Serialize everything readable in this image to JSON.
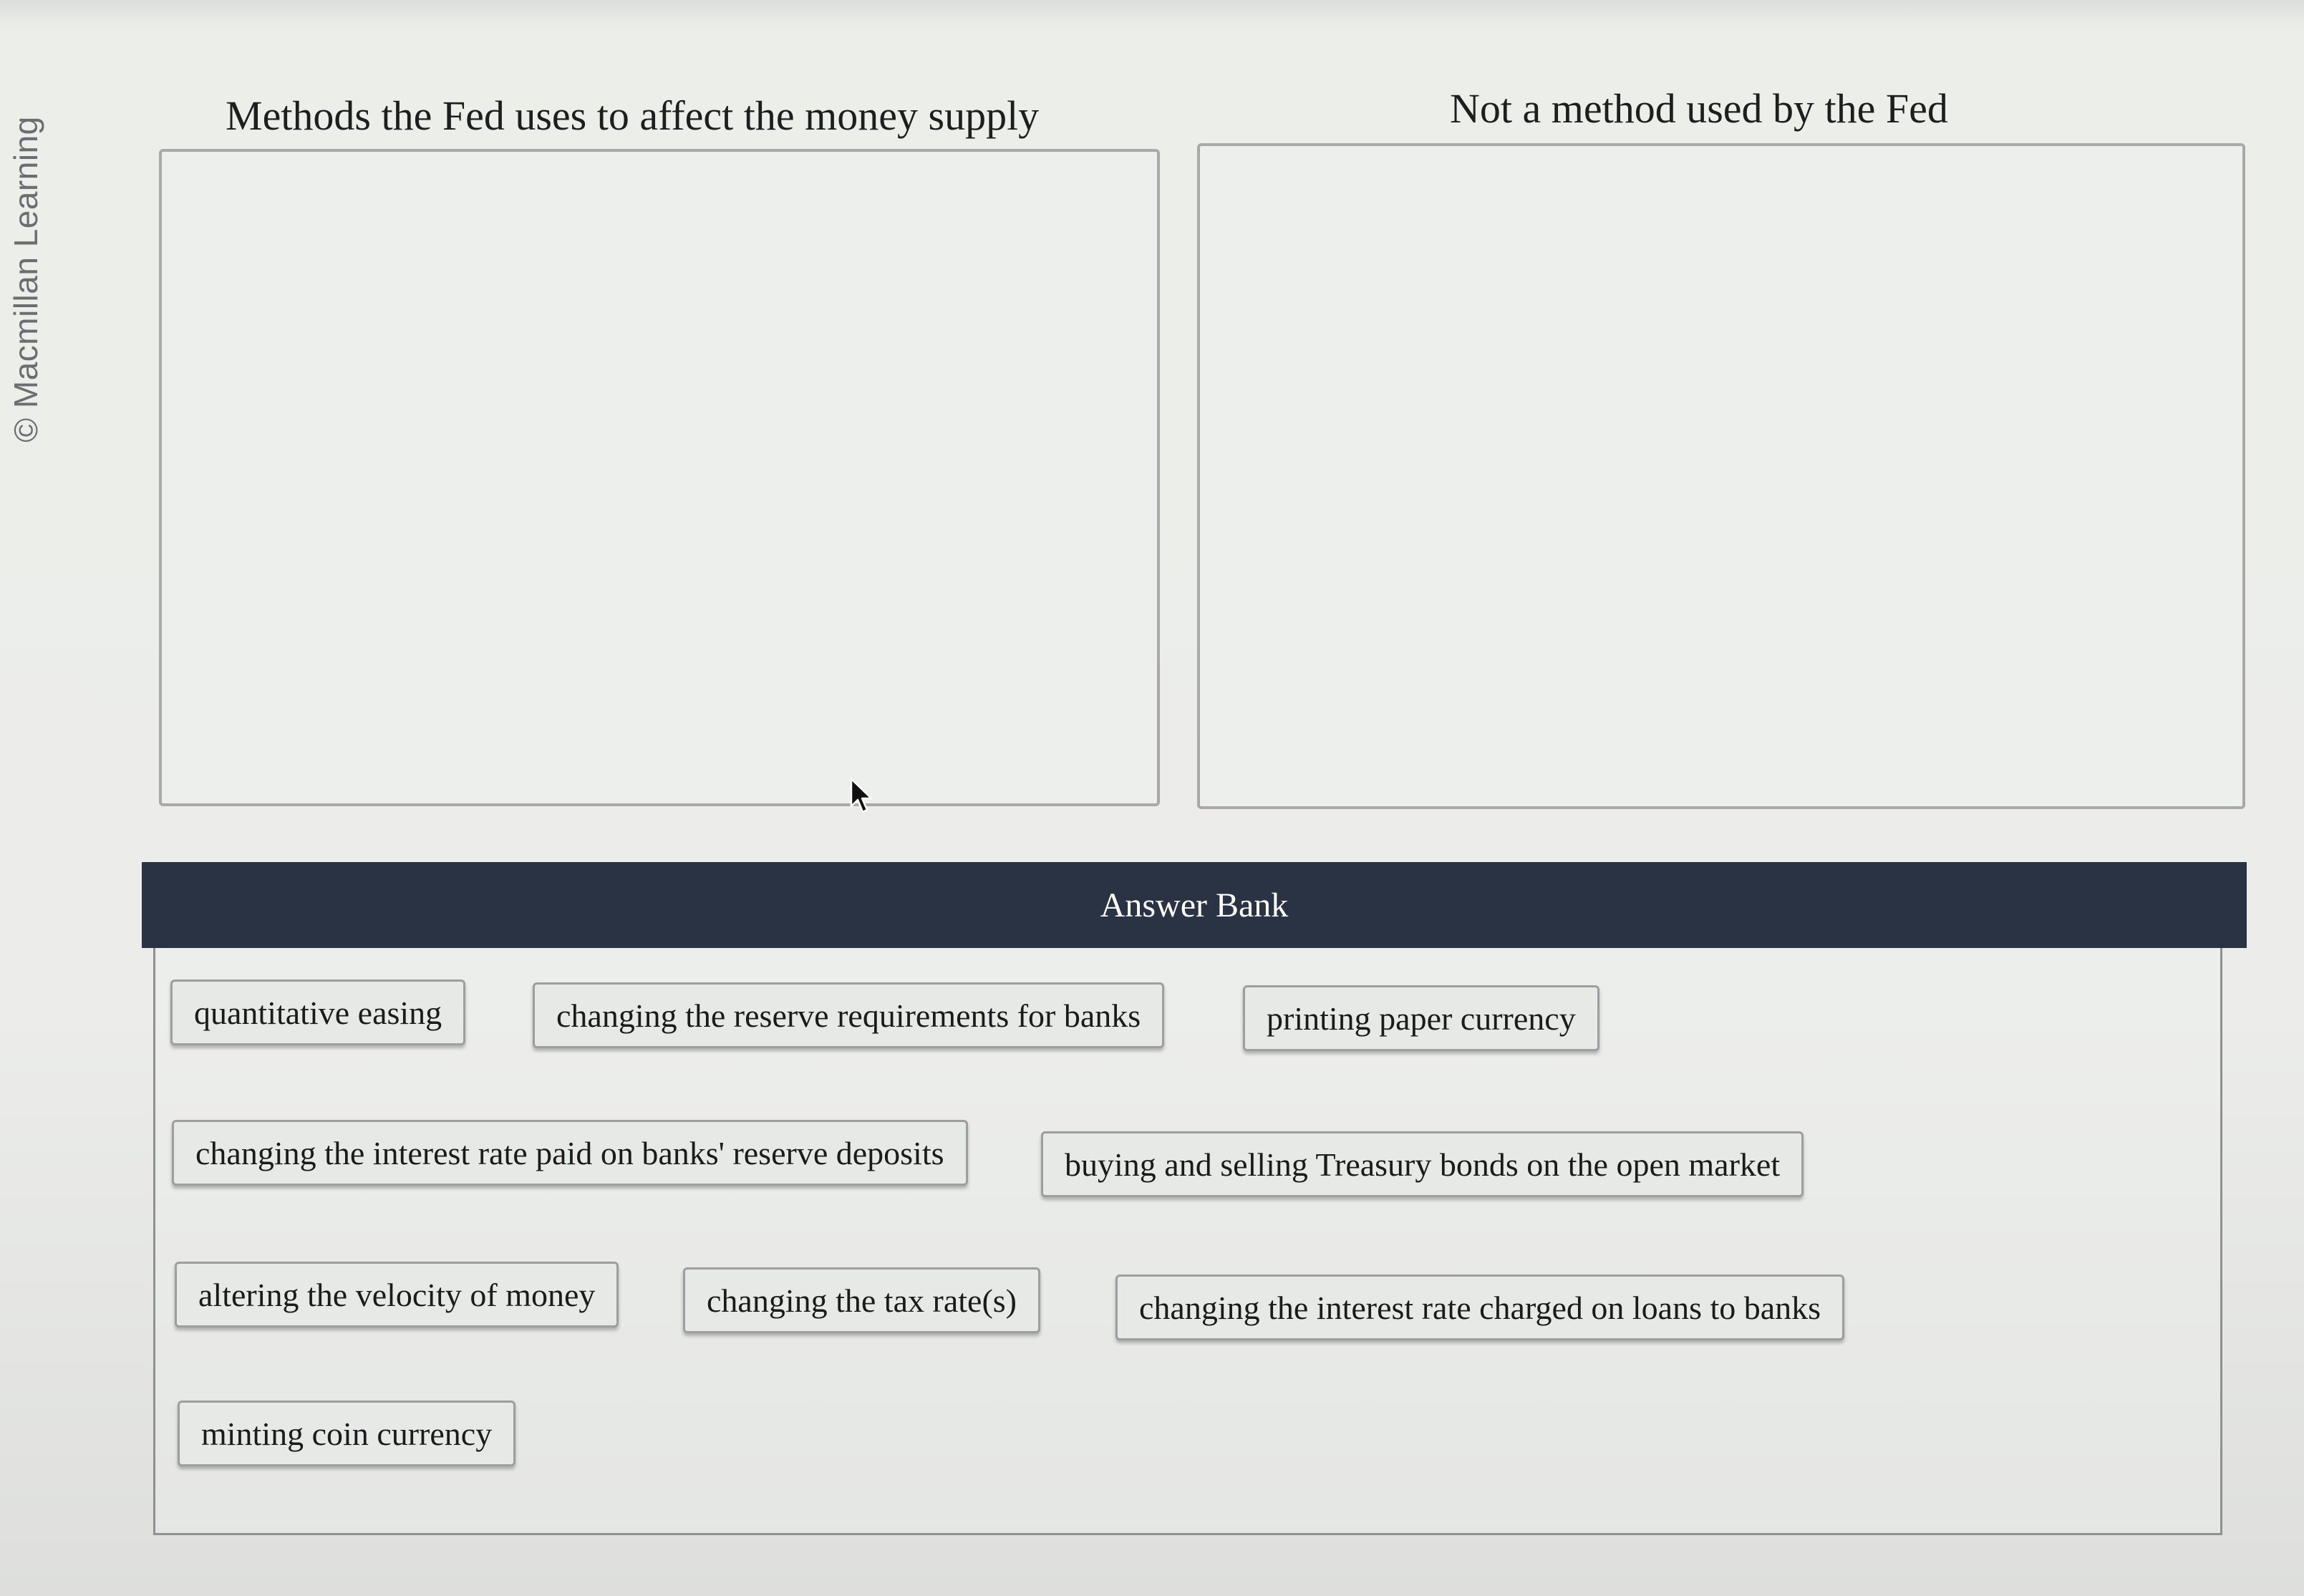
{
  "watermark": "© Macmillan Learning",
  "categories": {
    "left_heading": "Methods the Fed uses to affect the money supply",
    "right_heading": "Not a method used by the Fed"
  },
  "answer_bank": {
    "title": "Answer Bank",
    "items": [
      "quantitative easing",
      "changing the reserve requirements for banks",
      "printing paper currency",
      "changing the interest rate paid on banks' reserve deposits",
      "buying and selling Treasury bonds on the open market",
      "altering the velocity of money",
      "changing the tax rate(s)",
      "changing the interest rate charged on loans to banks",
      "minting coin currency"
    ]
  },
  "icons": {
    "cursor": "mouse-pointer-icon"
  }
}
